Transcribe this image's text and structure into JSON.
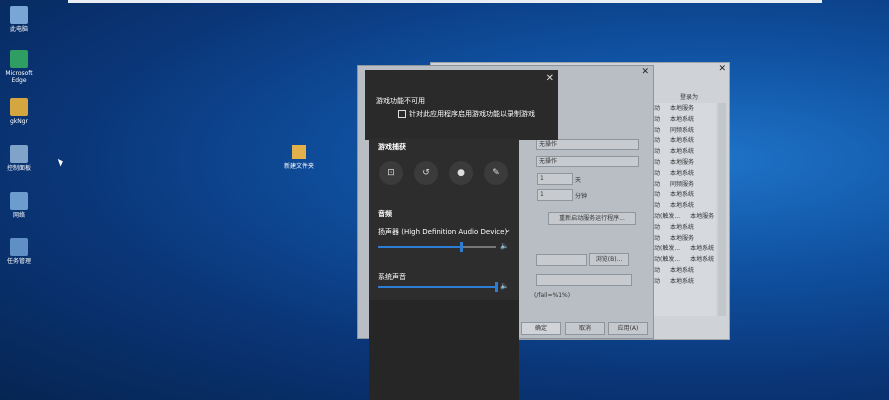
{
  "desktop": {
    "icons": [
      {
        "label": "此电脑",
        "color": "#7aa6d6"
      },
      {
        "label": "Microsoft Edge",
        "color": "#2f9e62"
      },
      {
        "label": "gkNgr",
        "color": "#d3a640"
      },
      {
        "label": "控制面板",
        "color": "#7fa3c9"
      },
      {
        "label": "网络",
        "color": "#6d9ccf"
      },
      {
        "label": "任务管理",
        "color": "#5f8fc4"
      }
    ],
    "folder_label": "新建文件夹"
  },
  "services": {
    "rows": [
      {
        "a": "动",
        "b": "本地服务"
      },
      {
        "a": "动",
        "b": "本地系统"
      },
      {
        "a": "动",
        "b": "同频系统"
      },
      {
        "a": "动",
        "b": "本地系统"
      },
      {
        "a": "动",
        "b": "本地系统"
      },
      {
        "a": "动",
        "b": "本地服务"
      },
      {
        "a": "动",
        "b": "本地系统"
      },
      {
        "a": "动",
        "b": "同频服务"
      },
      {
        "a": "动",
        "b": "本地系统"
      },
      {
        "a": "动",
        "b": "本地系统"
      },
      {
        "a": "动(触发...",
        "b": "本地服务"
      },
      {
        "a": "动",
        "b": "本地系统"
      },
      {
        "a": "动",
        "b": "本地服务"
      },
      {
        "a": "动(触发...",
        "b": "本地系统"
      },
      {
        "a": "动(触发...",
        "b": "本地系统"
      },
      {
        "a": "动",
        "b": "本地系统"
      },
      {
        "a": "动",
        "b": "本地系统"
      }
    ],
    "header": "登录为"
  },
  "dialog": {
    "field_none1": "无操作",
    "field_none2": "无操作",
    "days_value": "1",
    "days_unit": "天",
    "minutes_value": "1",
    "minutes_unit": "分钟",
    "restart_button": "重新启动服务运行程序...",
    "browse_button": "浏览(B)...",
    "params_text": "(/fail=%1%)",
    "ok_button": "确定",
    "cancel_button": "取消",
    "apply_button": "应用(A)"
  },
  "gamebar": {
    "unavailable_title": "游戏功能不可用",
    "checkbox_label": "针对此应用程序启用游戏功能以录制游戏",
    "capture_header": "游戏捕获",
    "capture_buttons": [
      {
        "name": "screenshot-icon",
        "glyph": "⊡"
      },
      {
        "name": "record-last-icon",
        "glyph": "↺"
      },
      {
        "name": "record-icon",
        "glyph": "●"
      },
      {
        "name": "mic-off-icon",
        "glyph": "✎"
      }
    ],
    "audio_header": "音频",
    "device_label": "扬声器 (High Definition Audio Device)",
    "device_volume": 0.7,
    "system_sound_label": "系统声音",
    "system_volume": 1.0,
    "speaker_glyph": "🔈"
  }
}
